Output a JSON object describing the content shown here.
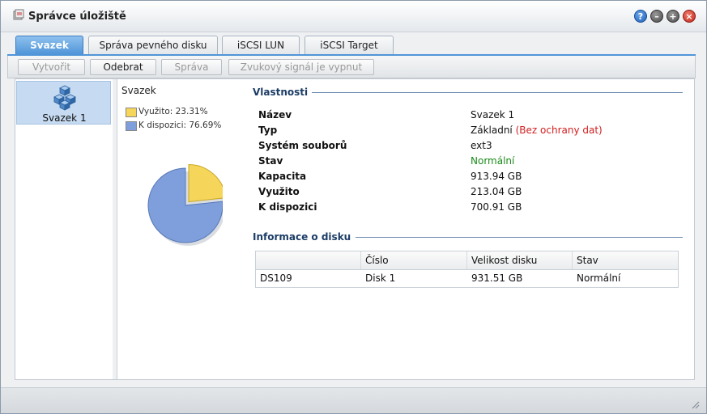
{
  "window": {
    "title": "Správce úložiště",
    "controls": {
      "help": "?",
      "minimize": "–",
      "maximize": "+",
      "close": "×"
    }
  },
  "tabs": [
    {
      "label": "Svazek",
      "active": true
    },
    {
      "label": "Správa pevného disku",
      "active": false
    },
    {
      "label": "iSCSI LUN",
      "active": false
    },
    {
      "label": "iSCSI Target",
      "active": false
    }
  ],
  "toolbar": {
    "create": "Vytvořit",
    "remove": "Odebrat",
    "manage": "Správa",
    "beep": "Zvukový signál je vypnut"
  },
  "volumes": [
    {
      "label": "Svazek 1",
      "icon": "volume-cubes-icon"
    }
  ],
  "chart": {
    "title": "Svazek",
    "legend": [
      {
        "label": "Využito: 23.31%",
        "color": "#f5d55a"
      },
      {
        "label": "K dispozici: 76.69%",
        "color": "#7f9fdc"
      }
    ]
  },
  "chart_data": {
    "type": "pie",
    "categories": [
      "Využito",
      "K dispozici"
    ],
    "values": [
      23.31,
      76.69
    ],
    "colors": [
      "#f5d55a",
      "#7f9fdc"
    ],
    "title": "Svazek"
  },
  "properties": {
    "title": "Vlastnosti",
    "rows": [
      {
        "label": "Název",
        "value": "Svazek 1"
      },
      {
        "label": "Typ",
        "value": "Základní",
        "note": "(Bez ochrany dat)"
      },
      {
        "label": "Systém souborů",
        "value": "ext3"
      },
      {
        "label": "Stav",
        "value": "Normální"
      },
      {
        "label": "Kapacita",
        "value": "913.94 GB"
      },
      {
        "label": "Využito",
        "value": "213.04 GB"
      },
      {
        "label": "K dispozici",
        "value": "700.91 GB"
      }
    ]
  },
  "disk_info": {
    "title": "Informace o disku",
    "columns": [
      "",
      "Číslo",
      "Velikost disku",
      "Stav"
    ],
    "rows": [
      [
        "DS109",
        "Disk 1",
        "931.51 GB",
        "Normální"
      ]
    ]
  },
  "colors": {
    "accent": "#4f95d8",
    "ok": "#1a8a1a",
    "warn": "#d11e1e"
  }
}
